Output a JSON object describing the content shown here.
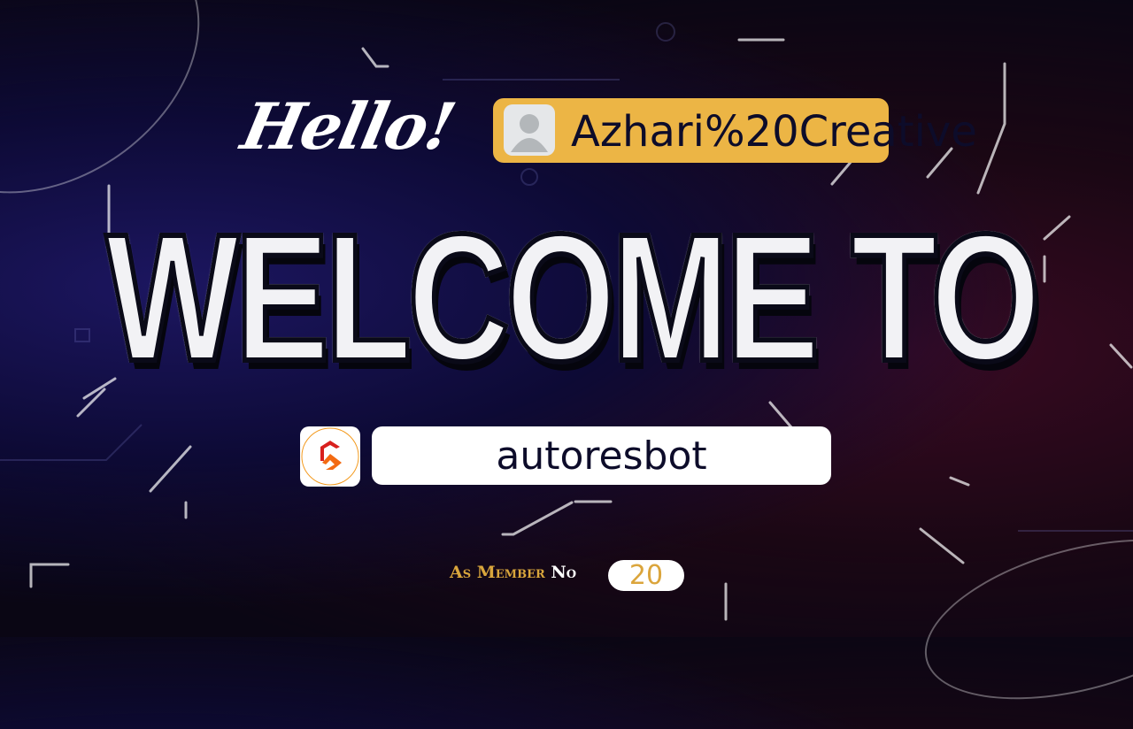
{
  "greeting": "Hello!",
  "user": {
    "name": "Azhari%20Creative",
    "avatar_icon": "default-avatar-icon"
  },
  "headline": "WELCOME TO",
  "server": {
    "name": "autoresbot",
    "icon": "server-logo-icon"
  },
  "member": {
    "label_prefix": "As Member",
    "label_suffix": "No",
    "number": "20"
  },
  "colors": {
    "accent": "#ecb545",
    "text_dark": "#0d0c2a",
    "gold": "#d9a63c"
  }
}
